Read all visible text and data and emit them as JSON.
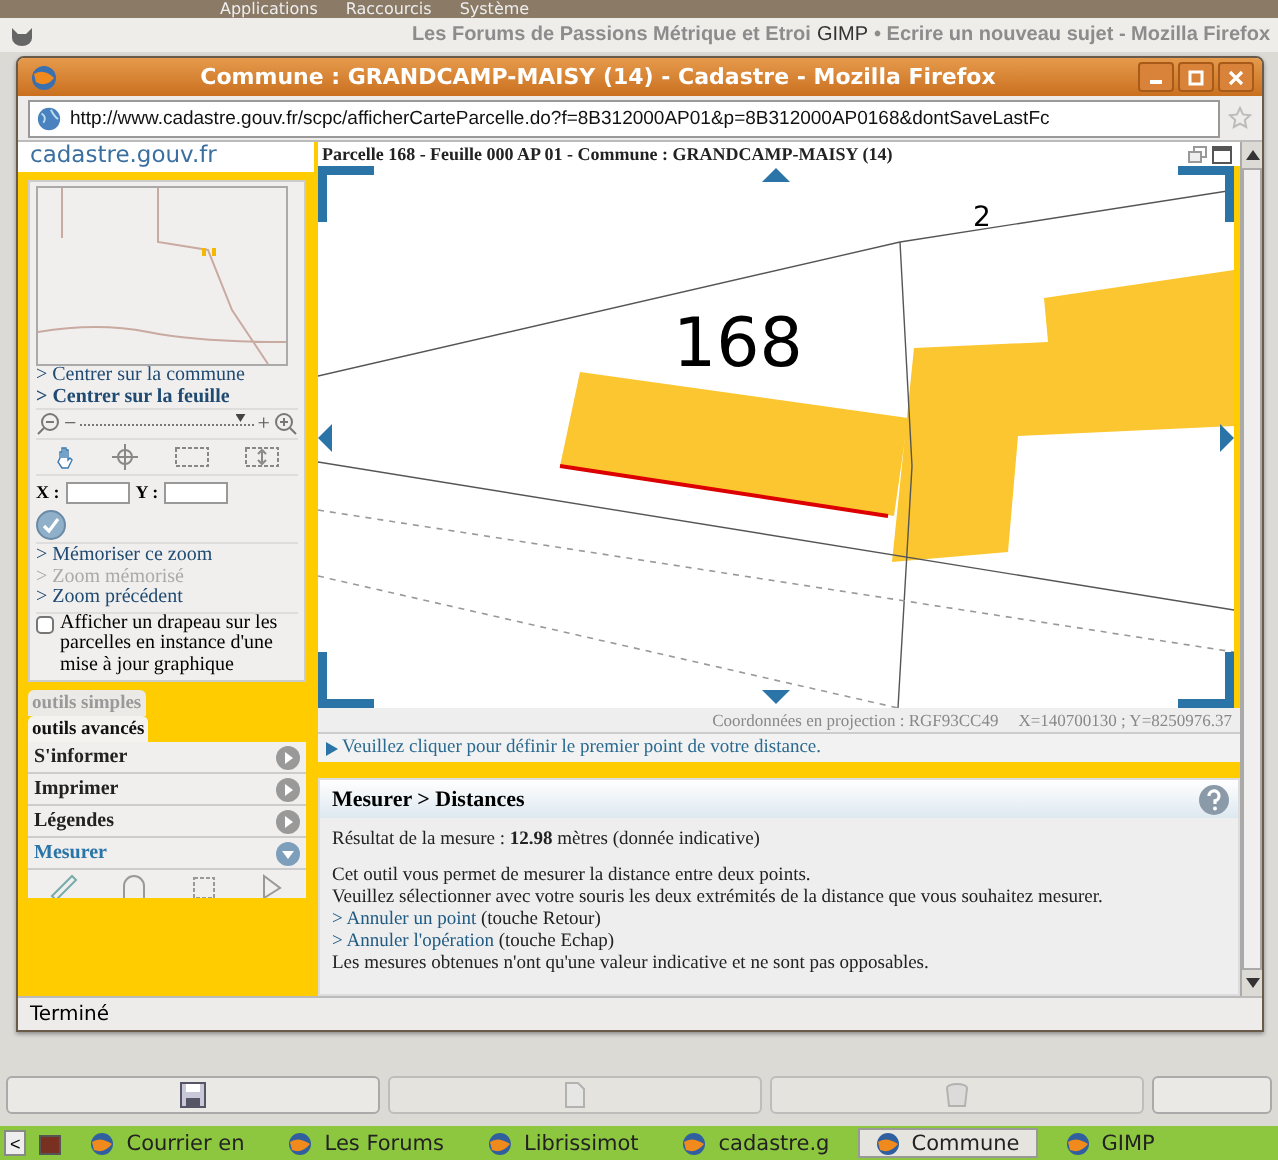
{
  "top_panel": {
    "menus": [
      "Applications",
      "Raccourcis",
      "Système"
    ]
  },
  "gimp_bar": {
    "title_left": "Les Forums de Passions Métrique et Etroi",
    "title_center": "GIMP",
    "title_right": "• Ecrire un nouveau sujet - Mozilla Firefox"
  },
  "window": {
    "title": "Commune : GRANDCAMP-MAISY (14) - Cadastre - Mozilla Firefox"
  },
  "url_bar": {
    "value": "http://www.cadastre.gouv.fr/scpc/afficherCarteParcelle.do?f=8B312000AP01&p=8B312000AP0168&dontSaveLastFc"
  },
  "sidebar": {
    "logo": "cadastre.gouv.fr",
    "center_links": [
      {
        "label": "> Centrer sur la commune",
        "emphasis": false
      },
      {
        "label": "> Centrer sur la feuille",
        "emphasis": true
      }
    ],
    "zoom": {
      "minus": "−",
      "plus": "+",
      "level": 0.93
    },
    "coords": {
      "x_label": "X :",
      "y_label": "Y :"
    },
    "zoom_links": [
      {
        "label": "> Mémoriser ce zoom",
        "disabled": false
      },
      {
        "label": "> Zoom mémorisé",
        "disabled": true
      },
      {
        "label": "> Zoom précédent",
        "disabled": false
      }
    ],
    "flag_option": {
      "label": "Afficher un drapeau sur les parcelles en instance d'une mise à jour graphique",
      "checked": false
    },
    "tool_tabs": [
      {
        "label": "outils simples",
        "selected": false
      },
      {
        "label": "outils avancés",
        "selected": true
      }
    ],
    "tool_menu": [
      {
        "label": "S'informer",
        "expanded": false
      },
      {
        "label": "Imprimer",
        "expanded": false
      },
      {
        "label": "Légendes",
        "expanded": false
      },
      {
        "label": "Mesurer",
        "expanded": true
      }
    ]
  },
  "map": {
    "header": "Parcelle 168 - Feuille 000 AP 01 - Commune : GRANDCAMP-MAISY (14)",
    "parcel_labels": [
      "168",
      "2"
    ],
    "projection": "Coordonnées en projection : RGF93CC49",
    "position": "X=140700130 ; Y=8250976.37",
    "instruction": "Veuillez cliquer pour définir le premier point de votre distance."
  },
  "measure_panel": {
    "title": "Mesurer > Distances",
    "result": "Résultat de la mesure : **12.98** mètres (donnée indicative)",
    "intro": "Cet outil vous permet de mesurer la distance entre deux points.",
    "instructions": "Veuillez sélectionner avec votre souris les deux extrémités de la distance que vous souhaitez mesurer.",
    "undo_point": {
      "link": "> Annuler un point",
      "note": "(touche Retour)"
    },
    "cancel": {
      "link": "> Annuler l'opération",
      "note": "(touche Echap)"
    },
    "disclaimer": "Les mesures obtenues n'ont qu'une valeur indicative et ne sont pas opposables."
  },
  "status_bar": {
    "text": "Terminé"
  },
  "gimp_buttons": [
    {
      "kind": "save",
      "disabled": false
    },
    {
      "kind": "copy",
      "disabled": true
    },
    {
      "kind": "delete",
      "disabled": true
    }
  ],
  "taskbar": {
    "scroll": "<",
    "items": [
      {
        "label": "Courrier en",
        "selected": false
      },
      {
        "label": "Les Forums",
        "selected": false
      },
      {
        "label": "Librissimot",
        "selected": false
      },
      {
        "label": "cadastre.g",
        "selected": false
      },
      {
        "label": "Commune",
        "selected": true
      },
      {
        "label": "GIMP",
        "selected": false
      }
    ]
  }
}
